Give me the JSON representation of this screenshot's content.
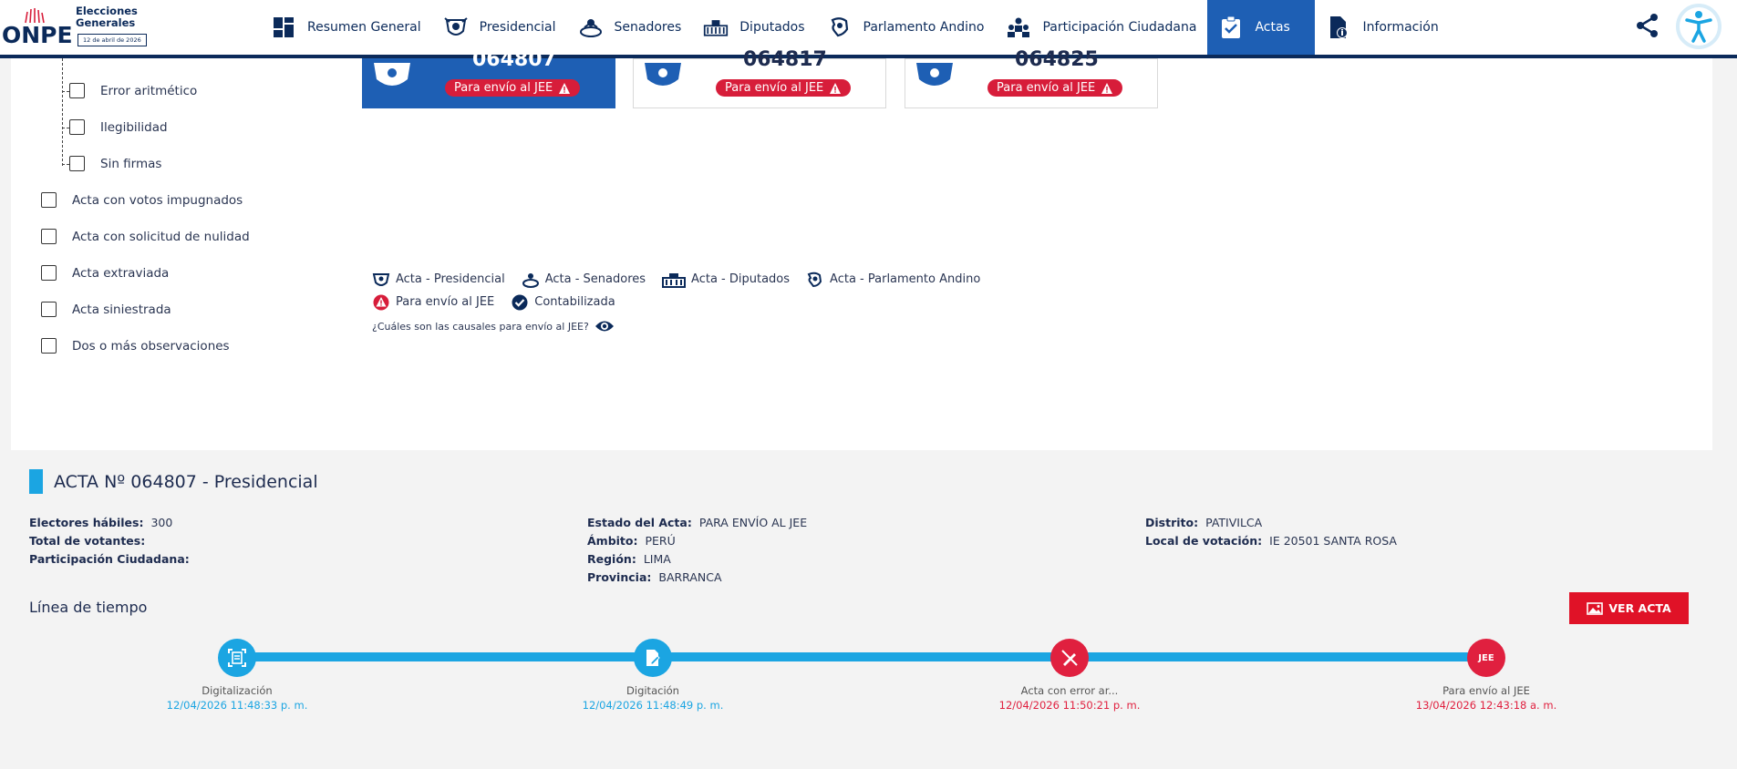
{
  "header": {
    "logo_text": "ONPE",
    "logo_line1": "Elecciones",
    "logo_line2": "Generales",
    "logo_date": "12 de abril de 2026",
    "nav": [
      {
        "label": "Resumen General",
        "icon": "dashboard-icon"
      },
      {
        "label": "Presidencial",
        "icon": "presidential-emblem-icon"
      },
      {
        "label": "Senadores",
        "icon": "senate-icon"
      },
      {
        "label": "Diputados",
        "icon": "congress-building-icon"
      },
      {
        "label": "Parlamento Andino",
        "icon": "andean-parliament-icon"
      },
      {
        "label": "Participación Ciudadana",
        "icon": "citizens-icon"
      },
      {
        "label": "Actas",
        "icon": "clipboard-check-icon"
      },
      {
        "label": "Información",
        "icon": "document-info-icon"
      }
    ],
    "active_nav": "Actas"
  },
  "filters": {
    "sub_items": [
      "Error aritmético",
      "Ilegibilidad",
      "Sin firmas"
    ],
    "items": [
      "Acta con votos impugnados",
      "Acta con solicitud de nulidad",
      "Acta extraviada",
      "Acta siniestrada",
      "Dos o más observaciones"
    ]
  },
  "cards": [
    {
      "number": "064807",
      "badge": "Para envío al JEE",
      "selected": true
    },
    {
      "number": "064817",
      "badge": "Para envío al JEE",
      "selected": false
    },
    {
      "number": "064825",
      "badge": "Para envío al JEE",
      "selected": false
    }
  ],
  "legend": {
    "presidencial": "Acta - Presidencial",
    "senadores": "Acta - Senadores",
    "diputados": "Acta - Diputados",
    "parlamento": "Acta - Parlamento Andino",
    "jee": "Para envío al JEE",
    "contabilizada": "Contabilizada",
    "question": "¿Cuáles son las causales para envío al JEE?"
  },
  "acta": {
    "title": "ACTA Nº 064807 - Presidencial",
    "electores_label": "Electores hábiles:",
    "electores_value": "300",
    "total_label": "Total de votantes:",
    "participacion_label": "Participación Ciudadana:",
    "estado_label": "Estado del Acta:",
    "estado_value": "PARA ENVÍO AL JEE",
    "ambito_label": "Ámbito:",
    "ambito_value": "PERÚ",
    "region_label": "Región:",
    "region_value": "LIMA",
    "provincia_label": "Provincia:",
    "provincia_value": "BARRANCA",
    "distrito_label": "Distrito:",
    "distrito_value": "PATIVILCA",
    "local_label": "Local de votación:",
    "local_value": "IE 20501 SANTA ROSA"
  },
  "timeline": {
    "title": "Línea de tiempo",
    "ver_acta": "VER ACTA",
    "steps": [
      {
        "label": "Digitalización",
        "date": "12/04/2026 11:48:33 p. m."
      },
      {
        "label": "Digitación",
        "date": "12/04/2026 11:48:49 p. m."
      },
      {
        "label": "Acta con error ar...",
        "date": "12/04/2026 11:50:21 p. m."
      },
      {
        "label": "Para envío al JEE",
        "date": "13/04/2026 12:43:18 a. m.",
        "node_text": "JEE"
      }
    ]
  },
  "colors": {
    "navy": "#0b2a5a",
    "active_blue": "#1e5fb4",
    "cyan": "#1ba5e2",
    "red": "#e0203f"
  }
}
